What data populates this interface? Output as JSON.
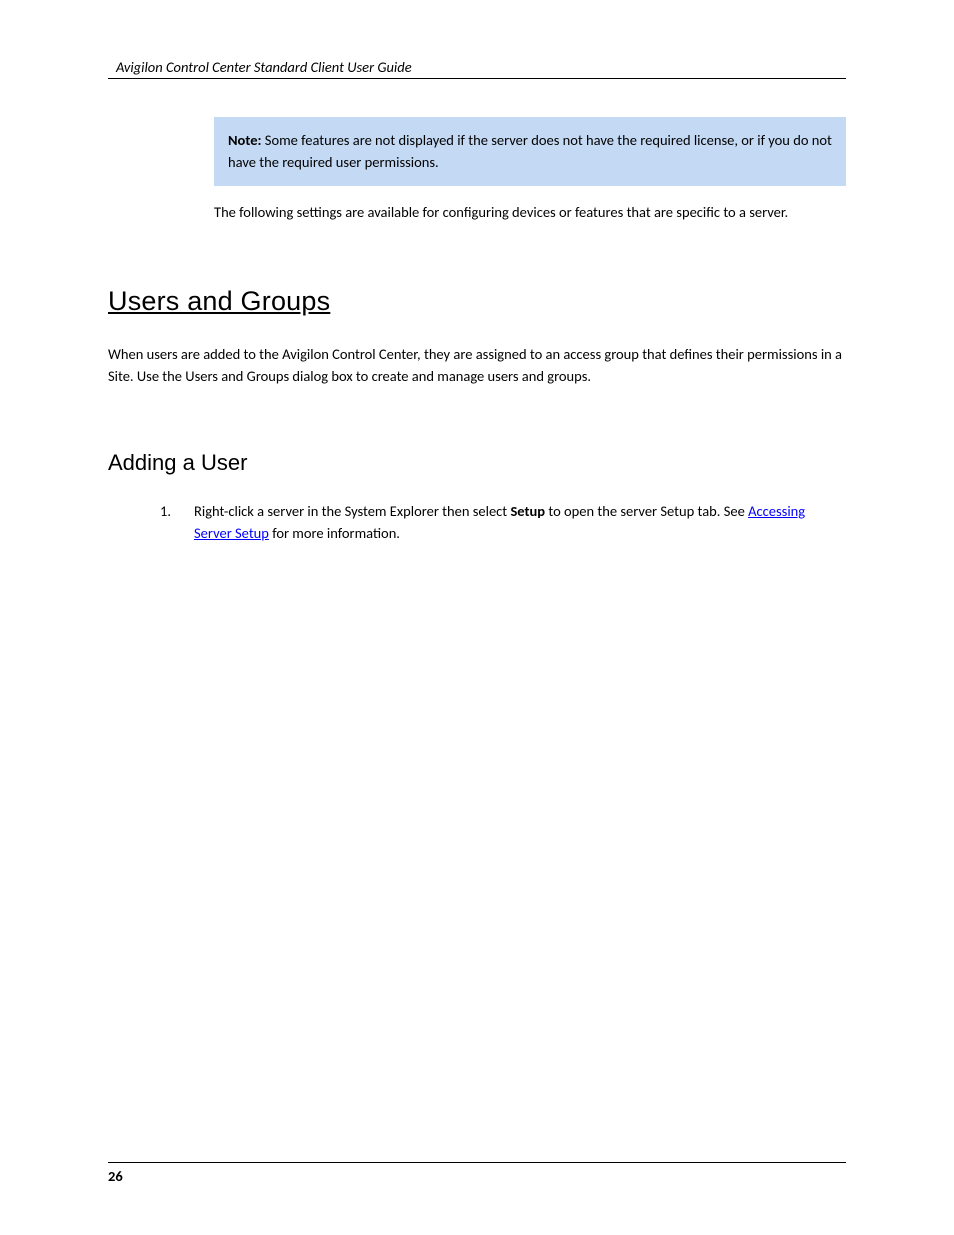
{
  "header": {
    "title": "Avigilon Control Center Standard Client User Guide"
  },
  "note": {
    "label": "Note:",
    "text": " Some features are not displayed if the server does not have the required license, or if you do not have the required user permissions."
  },
  "intro": "The following settings are available for configuring devices or features that are specific to a server.",
  "section": {
    "title": "Users and Groups",
    "desc": "When users are added to the Avigilon Control Center, they are assigned to an access group that defines their permissions in a Site. Use the Users and Groups dialog box to create and manage users and groups."
  },
  "subsection": {
    "title": "Adding a User"
  },
  "steps": [
    {
      "pre": "Right-click a server in the System Explorer then select ",
      "bold": "Setup",
      "post": " to open the server Setup tab. See ",
      "link": "Accessing Server Setup",
      "post2": " for more information."
    }
  ],
  "footer": {
    "page": "26"
  }
}
